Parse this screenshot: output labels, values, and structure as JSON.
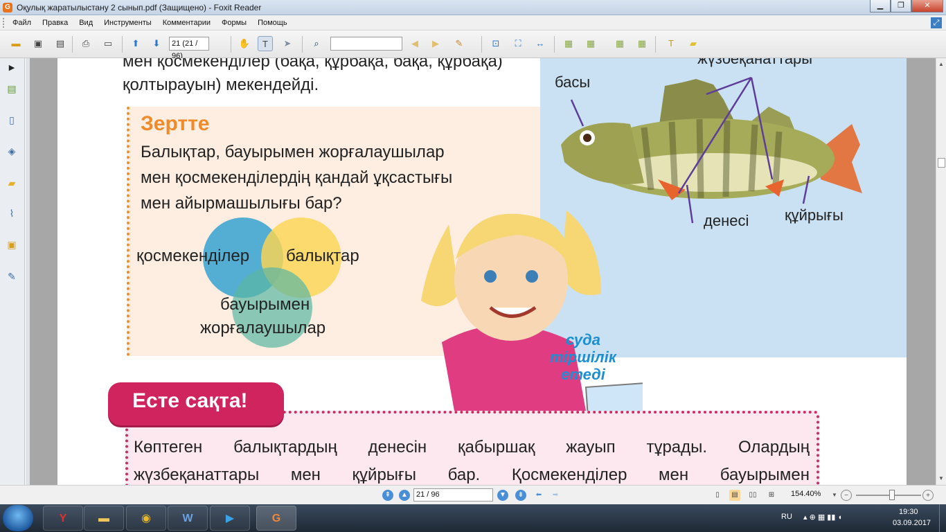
{
  "window": {
    "title": "Оқулық жаратылыстану 2 сынып.pdf (Защищено) - Foxit Reader",
    "app_icon": "foxit-logo-icon",
    "buttons": [
      "minimize",
      "maximize",
      "close"
    ]
  },
  "menu": {
    "items": [
      "Файл",
      "Правка",
      "Вид",
      "Инструменты",
      "Комментарии",
      "Формы",
      "Помощь"
    ]
  },
  "toolbar": {
    "page_field_value": "21 (21 / 96)",
    "find_field_value": "",
    "tool_icons": [
      "open-icon",
      "save-icon",
      "save-all-icon",
      "print-icon",
      "screen-icon",
      "previous-page-icon",
      "next-page-icon",
      "hand-tool-icon",
      "select-text-icon",
      "select-arrow-icon",
      "find-icon",
      "find-previous-icon",
      "find-next-icon",
      "highlight-icon",
      "actual-size-icon",
      "fit-page-icon",
      "fit-width-icon",
      "pdf-icon",
      "create-pdf-icon",
      "pdf-convert-icon",
      "pdf-export-icon",
      "typewriter-icon",
      "note-icon"
    ]
  },
  "left_panel": {
    "items": [
      "expand-panel-icon",
      "bookmarks-icon",
      "pages-icon",
      "layers-icon",
      "comments-icon",
      "attachments-icon",
      "security-icon",
      "signatures-icon"
    ]
  },
  "document": {
    "top_text_line1": "мен қосмекенділер (бақа, құрбақа, бақа, құрбақа)",
    "top_text_line2": "қолтырауын) мекендейді.",
    "research": {
      "title": "Зертте",
      "question_line1": "Балықтар, бауырымен жорғалаушылар",
      "question_line2": "мен қосмекенділердің қандай ұқсастығы",
      "question_line3": "мен айырмашылығы бар?",
      "venn_labels": {
        "left": "қосмекенділер",
        "right": "балықтар",
        "bottom_line1": "бауырымен",
        "bottom_line2": "жорғалаушылар"
      },
      "venn_colors": {
        "left": "#2e9fd0",
        "right": "#fbd653",
        "bottom": "#5ab7a3"
      }
    },
    "fish_diagram": {
      "labels": {
        "fins": "жүзбеқанаттары",
        "head": "басы",
        "body": "денесі",
        "tail": "құйрығы"
      }
    },
    "girl_sign": {
      "line1": "суда",
      "line2": "тіршілік",
      "line3": "етеді"
    },
    "remember": {
      "title": "Есте сақта!",
      "body_line1": "Көптеген балықтардың денесін қабыршақ жауып тұрады. Олардың",
      "body_line2": "жүзбеқанаттары мен құйрығы бар. Қосмекенділер мен бауырымен"
    }
  },
  "statusbar": {
    "page_field_value": "21 / 96",
    "zoom_value": "154.40%",
    "zoom_slider_level": 0.55
  },
  "taskbar": {
    "apps": [
      "yandex-browser-icon",
      "file-explorer-icon",
      "chrome-icon",
      "word-icon",
      "media-player-icon",
      "foxit-reader-icon"
    ],
    "language": "RU",
    "time": "19:30",
    "date": "03.09.2017"
  }
}
